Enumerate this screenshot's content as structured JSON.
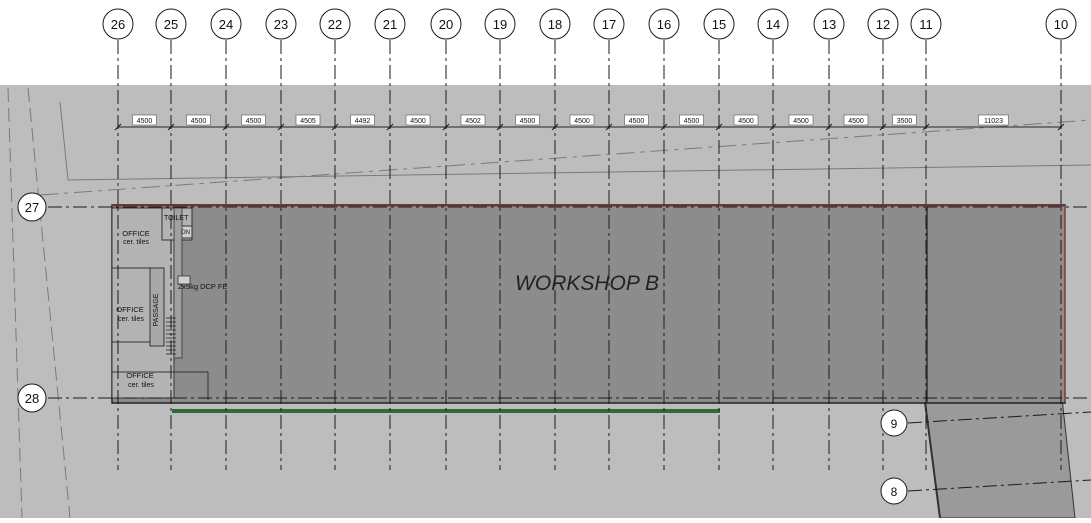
{
  "grid": {
    "columns": [
      "26",
      "25",
      "24",
      "23",
      "22",
      "21",
      "20",
      "19",
      "18",
      "17",
      "16",
      "15",
      "14",
      "13",
      "12",
      "11",
      "10"
    ],
    "rows": [
      "27",
      "28"
    ],
    "aux": [
      "9",
      "8"
    ]
  },
  "dimensions": [
    "4500",
    "4500",
    "4500",
    "4505",
    "4492",
    "4500",
    "4502",
    "4500",
    "4500",
    "4500",
    "4500",
    "4500",
    "4500",
    "4500",
    "3500",
    "11023"
  ],
  "building": {
    "title": "WORKSHOP B",
    "office_top": "OFFICE",
    "office_mid": "OFFICE",
    "office_bottom": "OFFICE",
    "finish": "cer. tiles",
    "toilet": "TOILET",
    "toilet_sub": "ON",
    "passage": "PASSAGE",
    "extinguisher": "2x9kg DCP FE"
  },
  "colors": {
    "plan_background": "#bdbdbd",
    "building_fill": "#8c8c8c",
    "annex_fill": "#9a9a9a",
    "grid_line": "#1a1a1a",
    "wall_accent": "#b04040",
    "green_strip": "#2f6b3a"
  }
}
